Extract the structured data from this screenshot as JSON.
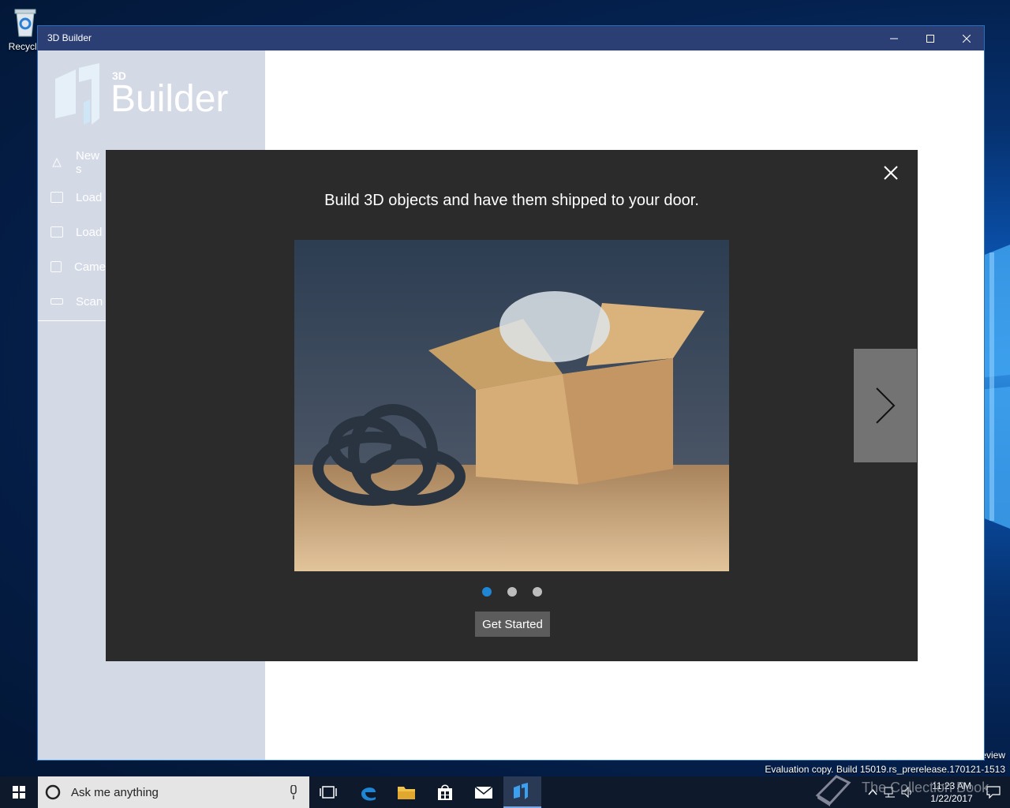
{
  "desktop": {
    "recycle_bin_label": "Recycle",
    "eval_line1": "eview",
    "eval_line2": "Evaluation copy. Build 15019.rs_prerelease.170121-1513"
  },
  "window": {
    "title": "3D Builder",
    "minimize_icon": "minimize-icon",
    "maximize_icon": "maximize-icon",
    "close_icon": "close-icon"
  },
  "sidebar": {
    "brand_small": "3D",
    "brand_name": "Builder",
    "items": [
      {
        "label": "New s",
        "icon": "new-scene-icon"
      },
      {
        "label": "Load",
        "icon": "load-object-icon"
      },
      {
        "label": "Load",
        "icon": "load-image-icon"
      },
      {
        "label": "Came",
        "icon": "camera-icon"
      },
      {
        "label": "Scan",
        "icon": "scan-icon"
      }
    ]
  },
  "modal": {
    "title": "Build 3D objects and have them shipped to your door.",
    "button_label": "Get Started",
    "dots": 3,
    "active_dot": 0,
    "accent": "#1e86d4",
    "background": "#2b2b2b"
  },
  "taskbar": {
    "search_placeholder": "Ask me anything",
    "time": "11:23 AM",
    "date": "1/22/2017"
  },
  "watermark": {
    "text": "The Collection Book"
  }
}
